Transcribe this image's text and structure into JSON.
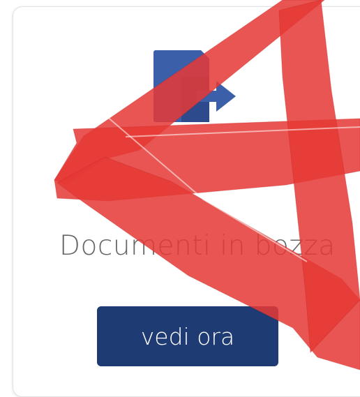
{
  "card": {
    "title": "Documenti in bozza",
    "button_label": "vedi ora",
    "icon": "document-export-icon"
  },
  "overlay": {
    "icon": "no-access-mark-icon",
    "color": "#e53935"
  },
  "colors": {
    "button_bg": "#1f3b73",
    "icon_blue": "#3b5fa8",
    "title_text": "#666666"
  }
}
